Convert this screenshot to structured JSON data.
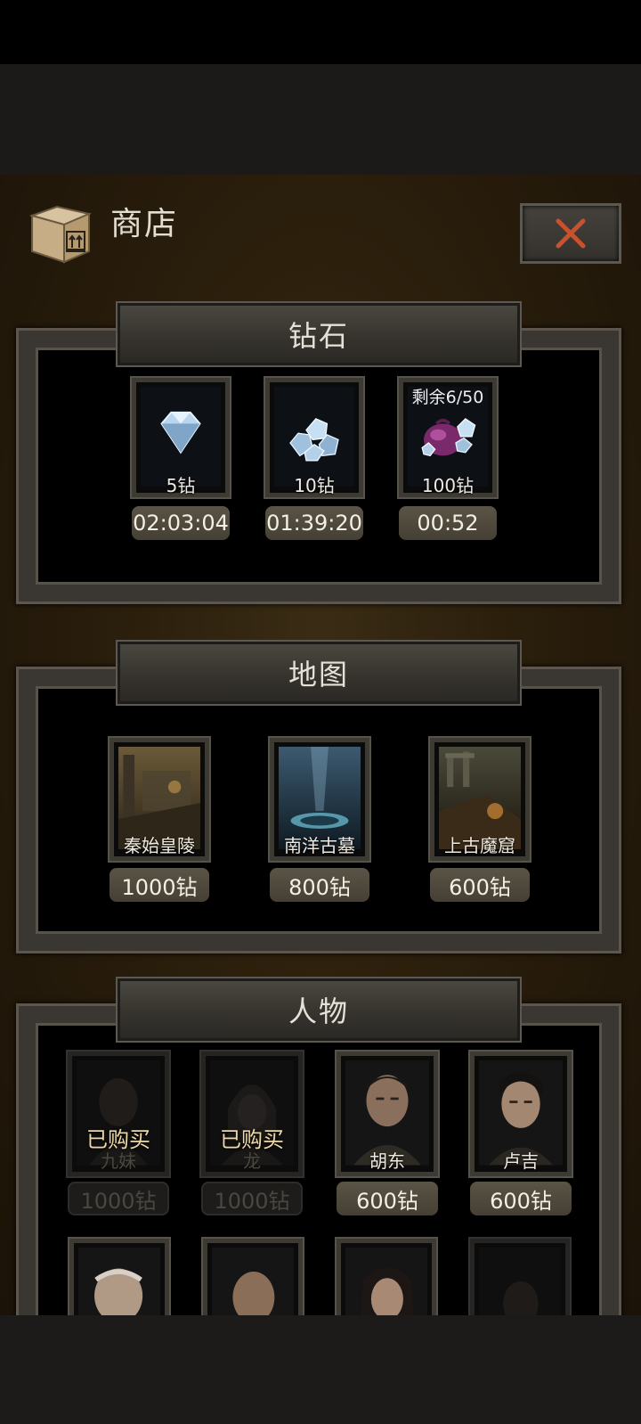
{
  "header": {
    "title": "商店",
    "close_label": "×"
  },
  "sections": {
    "diamond": {
      "title": "钻石",
      "items": [
        {
          "label": "5钻",
          "timer": "02:03:04",
          "icon": "diamond-small-icon"
        },
        {
          "label": "10钻",
          "timer": "01:39:20",
          "icon": "diamond-pile-icon"
        },
        {
          "label": "100钻",
          "timer": "00:52",
          "note": "剩余6/50",
          "icon": "diamond-bag-icon"
        }
      ]
    },
    "map": {
      "title": "地图",
      "items": [
        {
          "label": "秦始皇陵",
          "price": "1000钻"
        },
        {
          "label": "南洋古墓",
          "price": "800钻"
        },
        {
          "label": "上古魔窟",
          "price": "600钻"
        }
      ]
    },
    "character": {
      "title": "人物",
      "items": [
        {
          "label": "九妹",
          "price": "1000钻",
          "status": "已购买"
        },
        {
          "label": "龙",
          "price": "1000钻",
          "status": "已购买"
        },
        {
          "label": "胡东",
          "price": "600钻"
        },
        {
          "label": "卢吉",
          "price": "600钻"
        }
      ]
    }
  },
  "colors": {
    "accent_close": "#c9512e",
    "price_bg": "#4f483b",
    "banner_bg": "#3e3b35"
  }
}
